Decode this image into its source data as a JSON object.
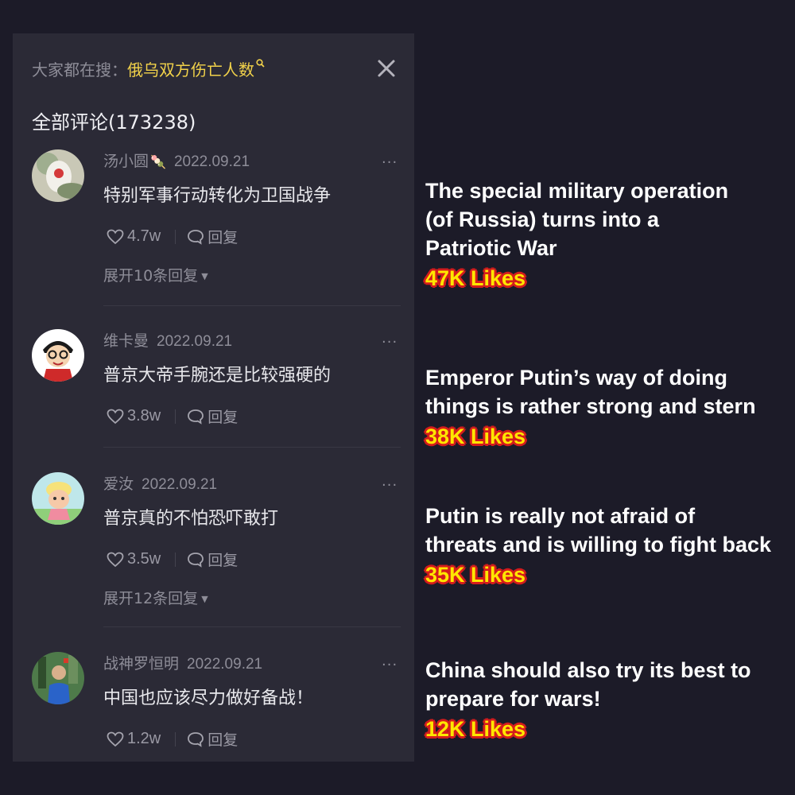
{
  "panel": {
    "search_prefix": "大家都在搜：",
    "search_term": "俄乌双方伤亡人数",
    "comment_count_title": "全部评论(173238)",
    "reply_label": "回复"
  },
  "comments": [
    {
      "username": "汤小圆",
      "user_badge": "🍡",
      "date": "2022.09.21",
      "text": "特别军事行动转化为卫国战争",
      "likes": "4.7w",
      "expand": "展开10条回复"
    },
    {
      "username": "维卡曼",
      "date": "2022.09.21",
      "text": "普京大帝手腕还是比较强硬的",
      "likes": "3.8w"
    },
    {
      "username": "爱汝",
      "date": "2022.09.21",
      "text": "普京真的不怕恐吓敢打",
      "likes": "3.5w",
      "expand": "展开12条回复"
    },
    {
      "username": "战神罗恒明",
      "date": "2022.09.21",
      "text": "中国也应该尽力做好备战！",
      "likes": "1.2w"
    }
  ],
  "translations": [
    {
      "lines": [
        "The special military operation",
        "(of Russia) turns into a",
        "Patriotic War"
      ],
      "likes": "47K Likes"
    },
    {
      "lines": [
        "Emperor Putin’s way of doing",
        "things is rather strong and stern"
      ],
      "likes": "38K Likes"
    },
    {
      "lines": [
        "Putin is really not afraid of",
        "threats and is willing to fight back"
      ],
      "likes": "35K Likes"
    },
    {
      "lines": [
        "China should also try its best to",
        "prepare for wars!"
      ],
      "likes": "12K Likes"
    }
  ],
  "colors": {
    "background": "#1c1b28",
    "panel": "#2b2a36",
    "search_highlight": "#f2d24a",
    "likes_fill": "#ffe600",
    "likes_outline": "#d41c1c"
  },
  "icons": [
    "search-icon",
    "close-icon",
    "more-icon",
    "heart-icon",
    "reply-bubble-icon",
    "caret-down-icon"
  ]
}
